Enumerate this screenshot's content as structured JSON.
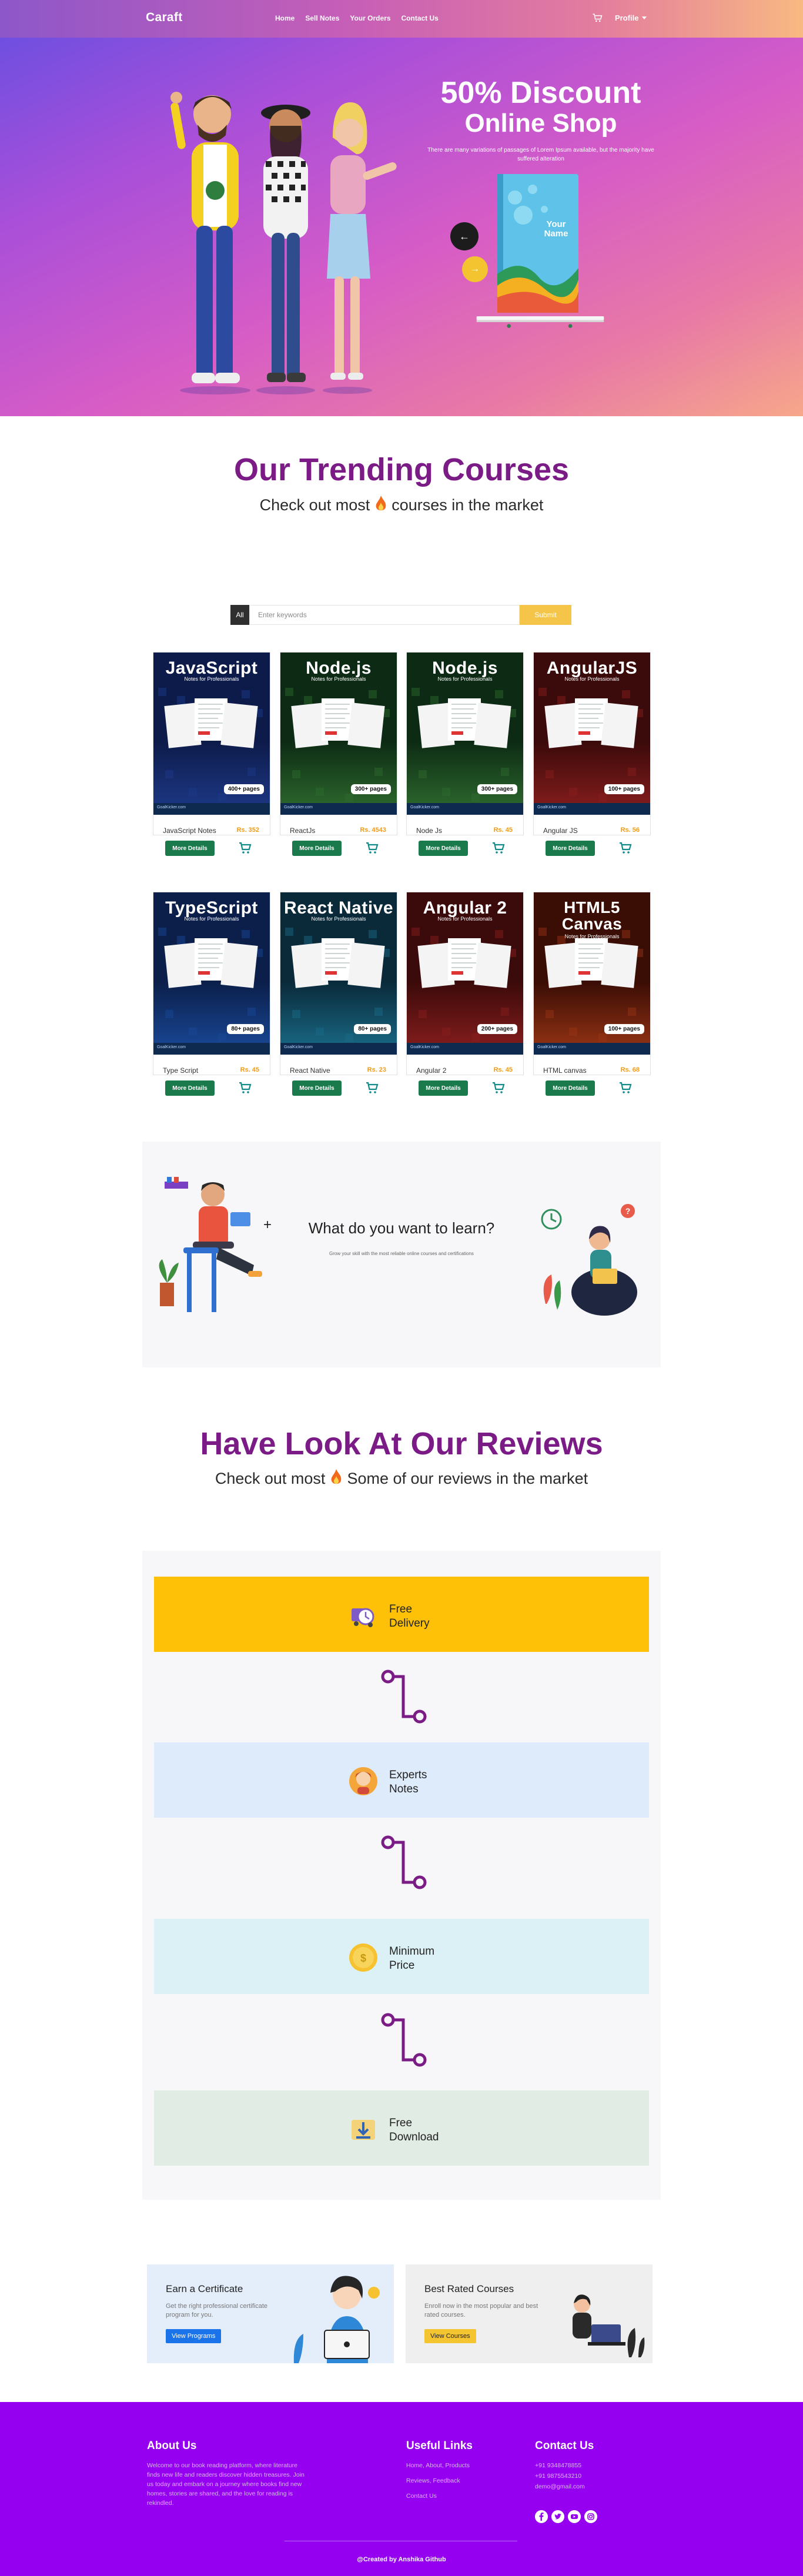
{
  "nav": {
    "brand": "Caraft",
    "links": [
      "Home",
      "Sell Notes",
      "Your Orders",
      "Contact Us"
    ],
    "profile_label": "Profile"
  },
  "hero": {
    "title_line1": "50% Discount",
    "title_line2": "Online Shop",
    "subtitle": "There are many variations of passages of Lorem Ipsum available, but the majority have suffered alteration",
    "prev_icon": "arrow-left-icon",
    "next_icon": "arrow-right-icon",
    "book_title": "Your Name"
  },
  "trending": {
    "title": "Our Trending Courses",
    "subtitle_before": "Check out most",
    "subtitle_after": "courses in the market"
  },
  "search": {
    "all_label": "All",
    "placeholder": "Enter keywords",
    "button_label": "Submit"
  },
  "courses": [
    {
      "cover_title": "JavaScript",
      "tagline": "Notes for Professionals",
      "pages": "400+ pages",
      "name": "JavaScript Notes",
      "price": "Rs. 352",
      "button": "More Details",
      "color": "#0d1b4a",
      "accent": "#1e3a8a"
    },
    {
      "cover_title": "Node.js",
      "tagline": "Notes for Professionals",
      "pages": "300+ pages",
      "name": "ReactJs",
      "price": "Rs. 4543",
      "button": "More Details",
      "color": "#0d2b14",
      "accent": "#2f6d2f"
    },
    {
      "cover_title": "Node.js",
      "tagline": "Notes for Professionals",
      "pages": "300+ pages",
      "name": "Node Js",
      "price": "Rs. 45",
      "button": "More Details",
      "color": "#0d2b14",
      "accent": "#2f6d2f"
    },
    {
      "cover_title": "AngularJS",
      "tagline": "Notes for Professionals",
      "pages": "100+ pages",
      "name": "Angular JS",
      "price": "Rs. 56",
      "button": "More Details",
      "color": "#3b0a0a",
      "accent": "#8b1e1e"
    },
    {
      "cover_title": "TypeScript",
      "tagline": "Notes for Professionals",
      "pages": "80+ pages",
      "name": "Type Script",
      "price": "Rs. 45",
      "button": "More Details",
      "color": "#0b1f4a",
      "accent": "#1a4a9a"
    },
    {
      "cover_title": "React Native",
      "tagline": "Notes for Professionals",
      "pages": "80+ pages",
      "name": "React Native",
      "price": "Rs. 23",
      "button": "More Details",
      "color": "#0a2a3a",
      "accent": "#1a6d8a"
    },
    {
      "cover_title": "Angular 2",
      "tagline": "Notes for Professionals",
      "pages": "200+ pages",
      "name": "Angular 2",
      "price": "Rs. 45",
      "button": "More Details",
      "color": "#3b0a0a",
      "accent": "#8b1e1e"
    },
    {
      "cover_title": "HTML5 Canvas",
      "tagline": "Notes for Professionals",
      "pages": "100+ pages",
      "name": "HTML canvas",
      "price": "Rs. 68",
      "button": "More Details",
      "color": "#3a0d05",
      "accent": "#9a3515"
    }
  ],
  "cover_footer": "GoalKicker.com",
  "learn": {
    "title": "What do you want to learn?",
    "subtitle": "Grow your skill with the most reliable online courses and certifications"
  },
  "reviews": {
    "title": "Have Look At Our Reviews",
    "subtitle_before": "Check out most",
    "subtitle_after": "Some of our reviews in the market",
    "features": [
      {
        "line1": "Free",
        "line2": "Delivery",
        "bg": "#ffc107",
        "icon": "delivery-clock-icon"
      },
      {
        "line1": "Experts",
        "line2": "Notes",
        "bg": "#deebfb",
        "icon": "expert-avatar-icon"
      },
      {
        "line1": "Minimum",
        "line2": "Price",
        "bg": "#dbf1f6",
        "icon": "coin-icon"
      },
      {
        "line1": "Free",
        "line2": "Download",
        "bg": "#e1ece4",
        "icon": "download-icon"
      }
    ]
  },
  "promos": [
    {
      "title": "Earn a Certificate",
      "text": "Get the right professional certificate program for you.",
      "button": "View Programs",
      "bg": "#e4eefb",
      "btn_bg": "#1a73e8",
      "btn_color": "#ffffff"
    },
    {
      "title": "Best Rated Courses",
      "text": "Enroll now in the most popular and best rated courses.",
      "button": "View Courses",
      "bg": "#efefef",
      "btn_bg": "#f5c531",
      "btn_color": "#222222"
    }
  ],
  "footer": {
    "about_title": "About Us",
    "about_text": "Welcome to our book reading platform, where literature finds new life and readers discover hidden treasures. Join us today and embark on a journey where books find new homes, stories are shared, and the love for reading is rekindled.",
    "links_title": "Useful Links",
    "links": [
      "Home, About, Products",
      "Reviews, Feedback",
      "Contact Us"
    ],
    "contact_title": "Contact Us",
    "contact": [
      "+91 9348478855",
      "+91 9875543210",
      "demo@gmail.com"
    ],
    "social_icons": [
      "facebook-icon",
      "twitter-icon",
      "youtube-icon",
      "instagram-icon"
    ],
    "credit": "@Created by Anshika Github"
  }
}
